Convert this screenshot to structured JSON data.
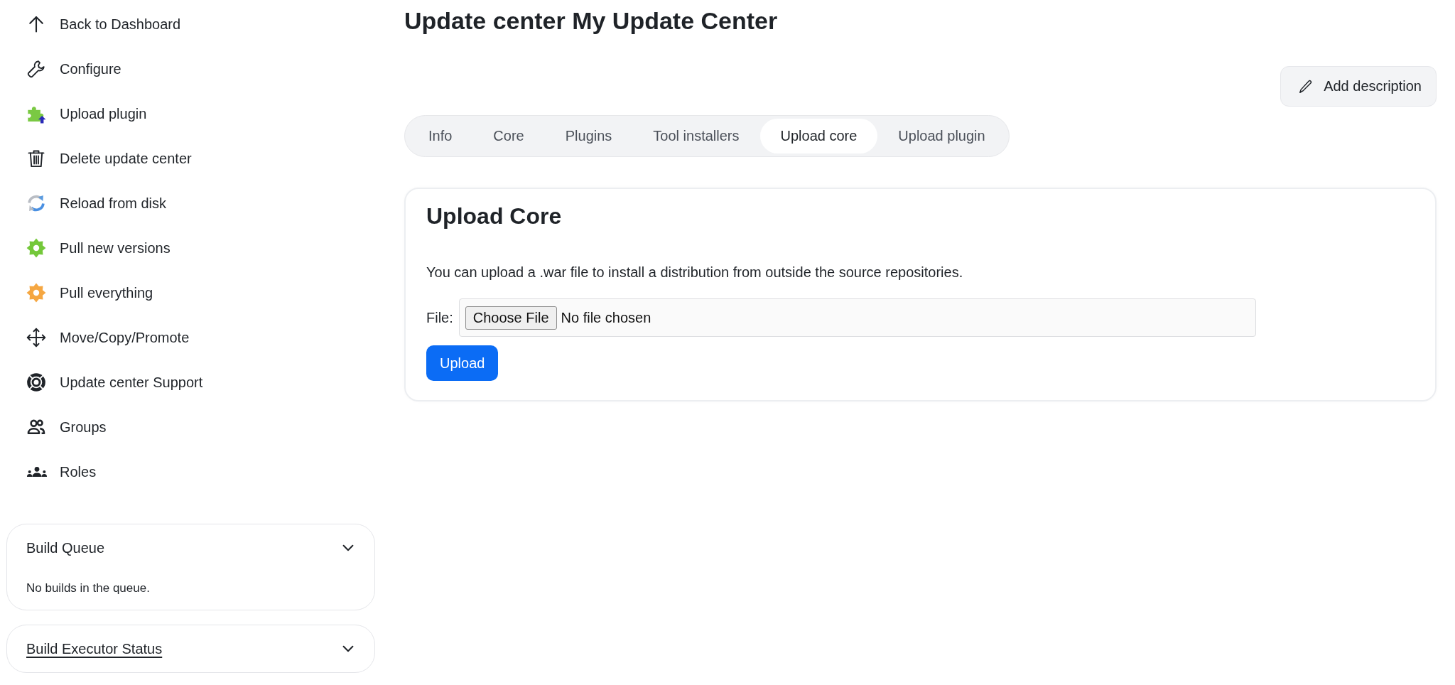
{
  "sidebar": {
    "items": [
      {
        "kind": "back",
        "label": "Back to Dashboard"
      },
      {
        "kind": "configure",
        "label": "Configure"
      },
      {
        "kind": "upload",
        "label": "Upload plugin"
      },
      {
        "kind": "delete",
        "label": "Delete update center"
      },
      {
        "kind": "reload",
        "label": "Reload from disk"
      },
      {
        "kind": "pullnew",
        "label": "Pull new versions"
      },
      {
        "kind": "pullall",
        "label": "Pull everything"
      },
      {
        "kind": "move",
        "label": "Move/Copy/Promote"
      },
      {
        "kind": "support",
        "label": "Update center Support"
      },
      {
        "kind": "groups",
        "label": "Groups"
      },
      {
        "kind": "roles",
        "label": "Roles"
      }
    ]
  },
  "widgets": [
    {
      "title": "Build Queue",
      "link": false,
      "body": "No builds in the queue."
    },
    {
      "title": "Build Executor Status",
      "link": true
    }
  ],
  "page": {
    "title": "Update center My Update Center",
    "add_description": "Add description"
  },
  "tabs": [
    {
      "label": "Info",
      "selected": false
    },
    {
      "label": "Core",
      "selected": false
    },
    {
      "label": "Plugins",
      "selected": false
    },
    {
      "label": "Tool installers",
      "selected": false
    },
    {
      "label": "Upload core",
      "selected": true
    },
    {
      "label": "Upload plugin",
      "selected": false
    }
  ],
  "upload": {
    "heading": "Upload Core",
    "description": "You can upload a .war file to install a distribution from outside the source repositories.",
    "file_label": "File:",
    "choose_button": "Choose File",
    "file_status": "No file chosen",
    "submit": "Upload"
  }
}
